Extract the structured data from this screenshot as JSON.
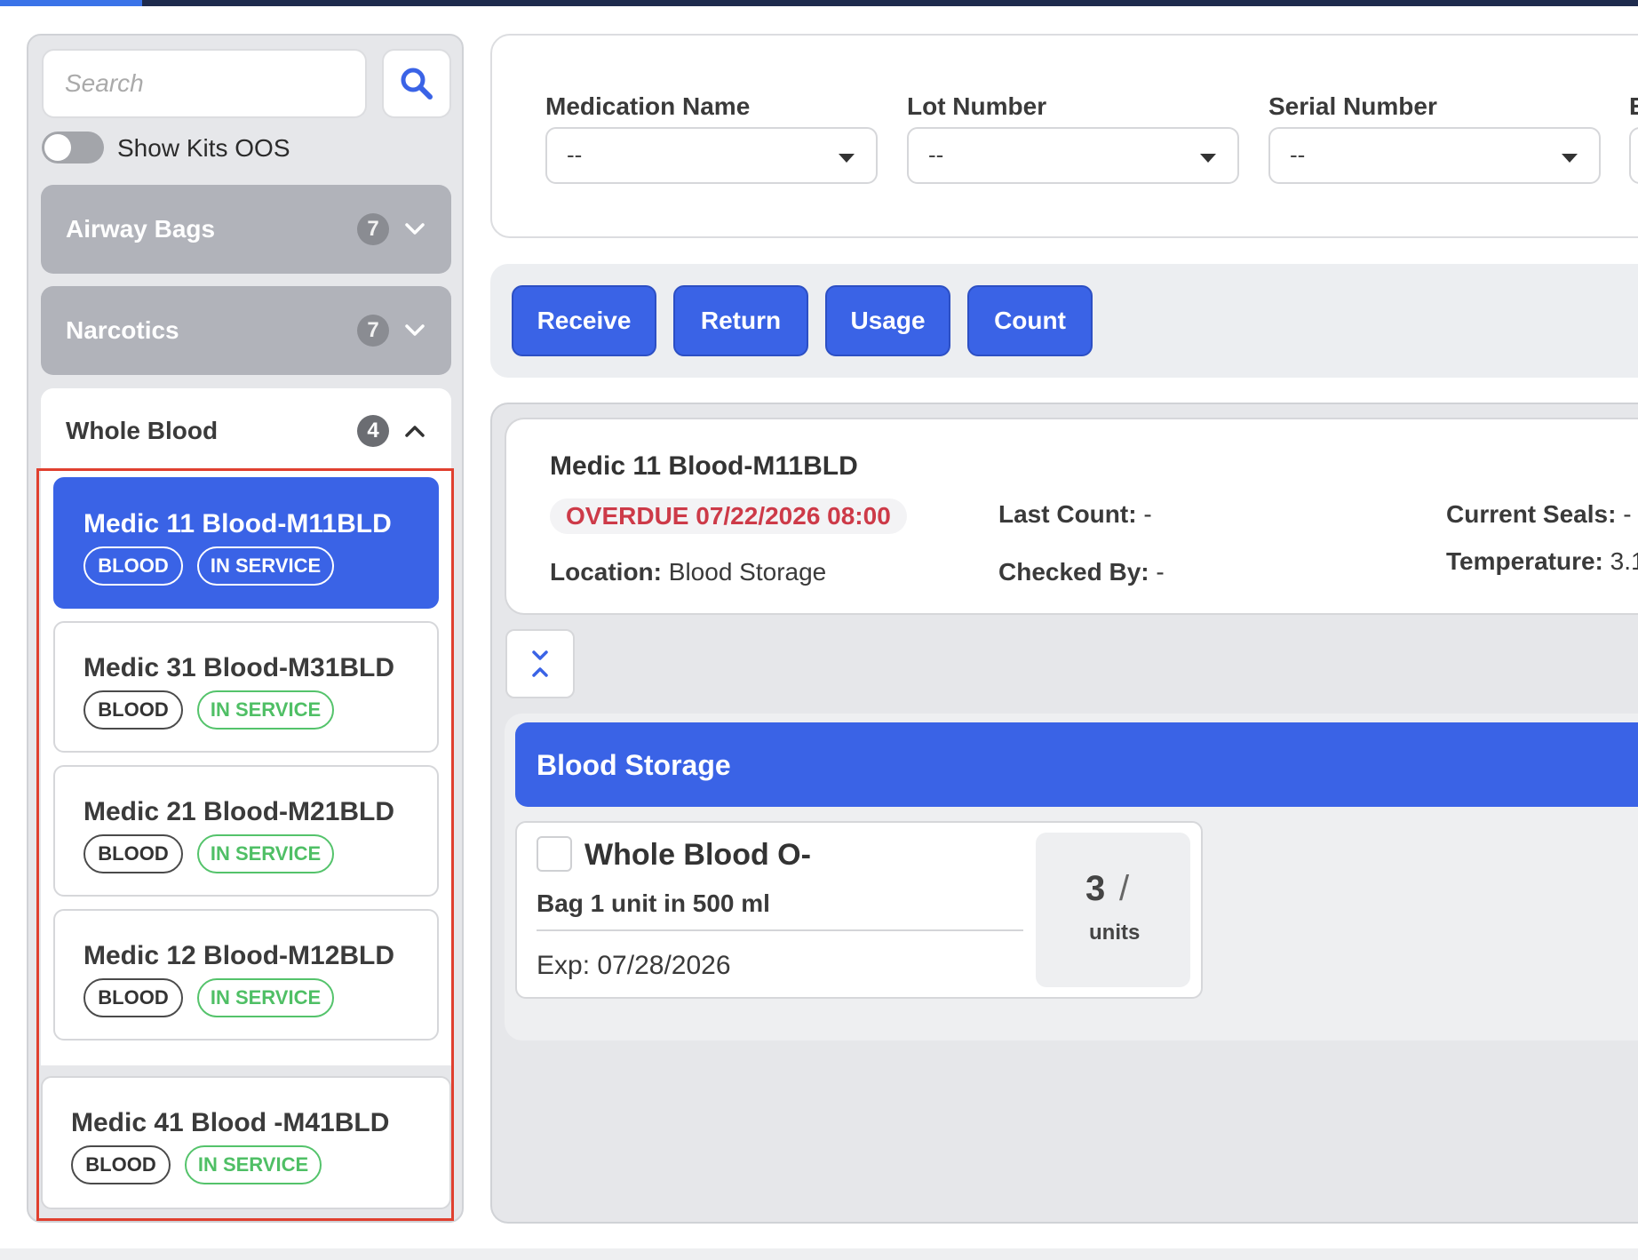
{
  "search": {
    "placeholder": "Search"
  },
  "toggle": {
    "label": "Show Kits OOS",
    "on": false
  },
  "groups": [
    {
      "name": "Airway Bags",
      "count": "7",
      "expanded": false
    },
    {
      "name": "Narcotics",
      "count": "7",
      "expanded": false
    },
    {
      "name": "Whole Blood",
      "count": "4",
      "expanded": true
    }
  ],
  "kits": [
    {
      "name": "Medic 11 Blood-M11BLD",
      "category": "BLOOD",
      "status": "IN SERVICE",
      "selected": true
    },
    {
      "name": "Medic 31 Blood-M31BLD",
      "category": "BLOOD",
      "status": "IN SERVICE",
      "selected": false
    },
    {
      "name": "Medic 21 Blood-M21BLD",
      "category": "BLOOD",
      "status": "IN SERVICE",
      "selected": false
    },
    {
      "name": "Medic 12 Blood-M12BLD",
      "category": "BLOOD",
      "status": "IN SERVICE",
      "selected": false
    },
    {
      "name": "Medic 41 Blood -M41BLD",
      "category": "BLOOD",
      "status": "IN SERVICE",
      "selected": false
    }
  ],
  "filters": [
    {
      "label": "Medication Name",
      "value": "--"
    },
    {
      "label": "Lot Number",
      "value": "--"
    },
    {
      "label": "Serial Number",
      "value": "--"
    },
    {
      "label": "E",
      "value": ""
    }
  ],
  "actions": [
    "Receive",
    "Return",
    "Usage",
    "Count"
  ],
  "kit_detail": {
    "title": "Medic 11 Blood-M11BLD",
    "overdue": "OVERDUE 07/22/2026 08:00",
    "location_label": "Location:",
    "location_value": "Blood Storage",
    "last_count_label": "Last Count:",
    "last_count_value": "-",
    "checked_by_label": "Checked By:",
    "checked_by_value": "-",
    "current_seals_label": "Current Seals:",
    "current_seals_value": "-",
    "temperature_label": "Temperature:",
    "temperature_value": "3.1"
  },
  "storage": {
    "title": "Blood Storage",
    "items": [
      {
        "name": "Whole Blood O-",
        "description": "Bag 1 unit in 500 ml",
        "exp": "Exp: 07/28/2026",
        "qty": "3",
        "slash": "/",
        "unit": "units"
      }
    ]
  },
  "colors": {
    "primary": "#3a63e6",
    "topbar": "#1e2b4d",
    "overdue": "#cd3a48",
    "in_service": "#4fbf65",
    "highlight_frame": "#e0402f"
  },
  "icons": [
    "search-icon",
    "chevron-down-icon",
    "chevron-up-icon",
    "collapse-icon",
    "dropdown-caret-icon"
  ]
}
